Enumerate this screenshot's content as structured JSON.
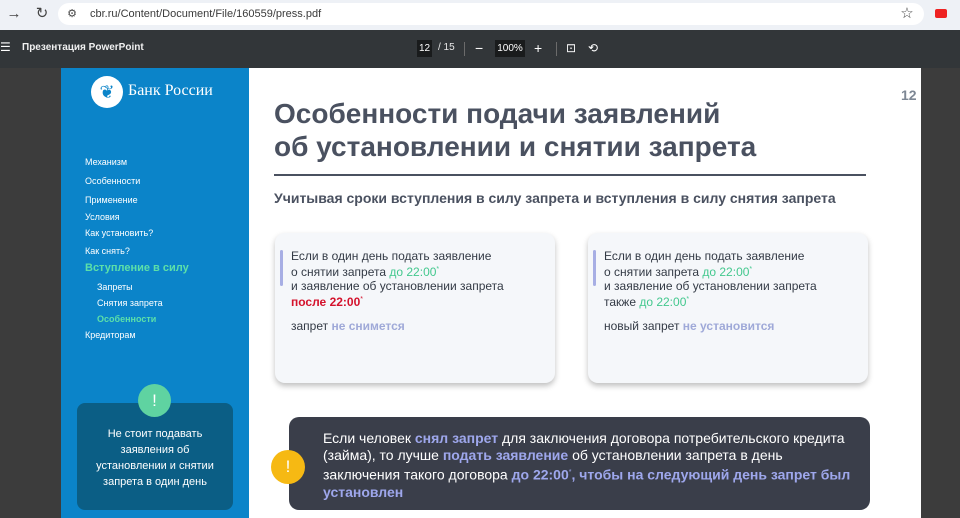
{
  "browser": {
    "url": "cbr.ru/Content/Document/File/160559/press.pdf",
    "back_icon": "arrow-right-icon",
    "reload_icon": "reload-icon"
  },
  "pdf_toolbar": {
    "title": "Презентация PowerPoint",
    "current_page": "12",
    "total_pages": "/ 15",
    "zoom": "100%"
  },
  "sidebar": {
    "bank_name": "Банк России",
    "items": [
      {
        "label": "Механизм"
      },
      {
        "label": "Особенности"
      },
      {
        "label": "Применение"
      },
      {
        "label": "Условия"
      },
      {
        "label": "Как установить?"
      },
      {
        "label": "Как снять?"
      },
      {
        "label": "Вступление в силу"
      },
      {
        "label": "Запреты"
      },
      {
        "label": "Снятия запрета"
      },
      {
        "label": "Особенности"
      },
      {
        "label": "Кредиторам"
      }
    ],
    "tip_badge": "!",
    "tip_text": "Не стоит подавать заявления об установлении и снятии запрета в один день"
  },
  "slide": {
    "page_number": "12",
    "title_line1": "Особенности подачи заявлений",
    "title_line2": "об установлении и снятии запрета",
    "subtitle": "Учитывая сроки вступления в силу запрета и вступления в силу снятия запрета",
    "card1": {
      "l1": "Если в один день подать заявление",
      "l2a": "о снятии запрета ",
      "l2b": "до 22:00",
      "l3": "и заявление об установлении запрета",
      "l4": "после 22:00",
      "res_a": "запрет ",
      "res_b": "не снимется"
    },
    "card2": {
      "l1": "Если в один день подать заявление",
      "l2a": "о снятии запрета ",
      "l2b": "до 22:00",
      "l3": "и заявление об установлении запрета",
      "l4a": "также ",
      "l4b": "до 22:00",
      "res_a": "новый запрет ",
      "res_b": "не установится"
    },
    "note": {
      "p1": "Если человек ",
      "p2": "снял запрет",
      "p3": " для заключения договора потребительского кредита (займа), то лучше ",
      "p4": "подать заявление",
      "p5": " об установлении запрета в день заключения такого договора ",
      "p6": "до 22:00",
      "p7": ", чтобы на следующий день запрет был установлен",
      "icon": "!"
    },
    "asterisk": "*"
  },
  "colors": {
    "sidebar_blue": "#0b84c9",
    "accent_green": "#43c88e",
    "accent_red": "#d4122c",
    "accent_lavender": "#9ea7ec",
    "dark_card": "#3a3e4a"
  }
}
